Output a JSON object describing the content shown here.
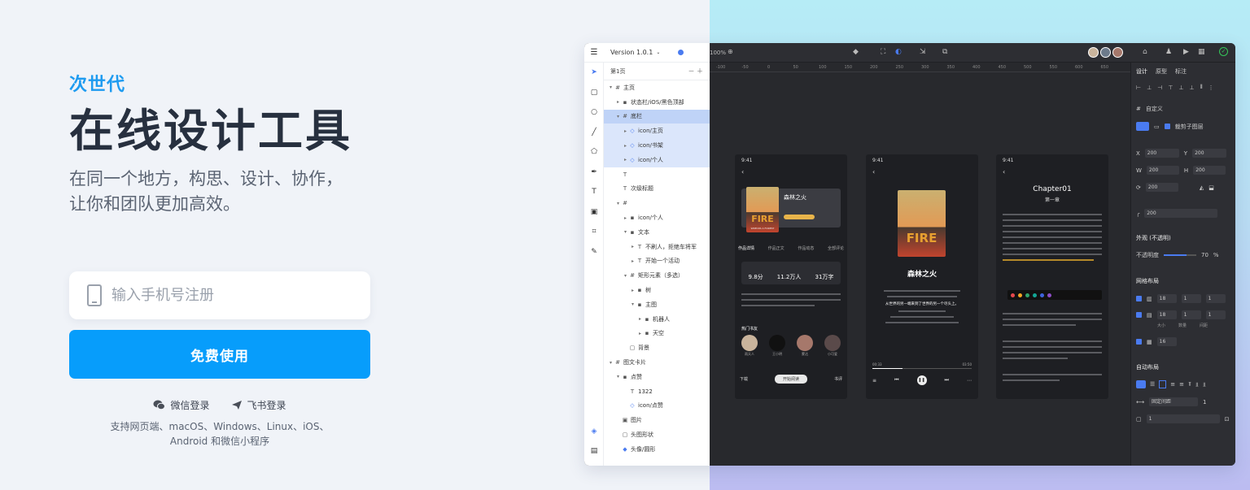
{
  "hero": {
    "tag": "次世代",
    "title": "在线设计工具",
    "subtitle_line1": "在同一个地方，构思、设计、协作，",
    "subtitle_line2": "让你和团队更加高效。"
  },
  "signup": {
    "phone_placeholder": "输入手机号注册",
    "free_button": "免费使用",
    "wechat_login": "微信登录",
    "feishu_login": "飞书登录",
    "platforms_line1": "支持网页端、macOS、Windows、Linux、iOS、",
    "platforms_line2": "Android 和微信小程序"
  },
  "editor": {
    "version": "Version 1.0.1",
    "page": "第1页",
    "zoom": "100%",
    "layers": [
      {
        "indent": 0,
        "arrow": "▾",
        "icon": "#",
        "label": "主页",
        "sel": false
      },
      {
        "indent": 1,
        "arrow": "▸",
        "icon": "▪",
        "label": "状态栏/iOS/黑色顶部",
        "sel": false
      },
      {
        "indent": 1,
        "arrow": "▾",
        "icon": "#",
        "label": "底栏",
        "sel": true,
        "head": true
      },
      {
        "indent": 2,
        "arrow": "▸",
        "icon": "◇",
        "label": "icon/主页",
        "sel": true
      },
      {
        "indent": 2,
        "arrow": "▸",
        "icon": "◇",
        "label": "icon/书架",
        "sel": true
      },
      {
        "indent": 2,
        "arrow": "▸",
        "icon": "◇",
        "label": "icon/个人",
        "sel": true
      },
      {
        "indent": 1,
        "arrow": "",
        "icon": "T",
        "label": "",
        "sel": false
      },
      {
        "indent": 1,
        "arrow": "",
        "icon": "T",
        "label": "次级标题",
        "sel": false
      },
      {
        "indent": 1,
        "arrow": "▾",
        "icon": "#",
        "label": "",
        "sel": false
      },
      {
        "indent": 2,
        "arrow": "▸",
        "icon": "▪",
        "label": "icon/个人",
        "sel": false
      },
      {
        "indent": 2,
        "arrow": "▾",
        "icon": "▪",
        "label": "文本",
        "sel": false
      },
      {
        "indent": 3,
        "arrow": "▸",
        "icon": "T",
        "label": "不刷人，拒绝车将军",
        "sel": false
      },
      {
        "indent": 3,
        "arrow": "▸",
        "icon": "T",
        "label": "开始一个活动",
        "sel": false
      },
      {
        "indent": 2,
        "arrow": "▾",
        "icon": "#",
        "label": "矩形元素（多选）",
        "sel": false
      },
      {
        "indent": 3,
        "arrow": "▸",
        "icon": "▪",
        "label": "树",
        "sel": false
      },
      {
        "indent": 3,
        "arrow": "▾",
        "icon": "▪",
        "label": "主图",
        "sel": false
      },
      {
        "indent": 4,
        "arrow": "▸",
        "icon": "▪",
        "label": "机器人",
        "sel": false
      },
      {
        "indent": 4,
        "arrow": "▸",
        "icon": "▪",
        "label": "天空",
        "sel": false
      },
      {
        "indent": 2,
        "arrow": "",
        "icon": "▢",
        "label": "背景",
        "sel": false
      },
      {
        "indent": 0,
        "arrow": "▾",
        "icon": "#",
        "label": "图文卡片",
        "sel": false
      },
      {
        "indent": 1,
        "arrow": "▾",
        "icon": "▪",
        "label": "点赞",
        "sel": false
      },
      {
        "indent": 2,
        "arrow": "",
        "icon": "T",
        "label": "1322",
        "sel": false
      },
      {
        "indent": 2,
        "arrow": "",
        "icon": "◇",
        "label": "icon/点赞",
        "sel": false
      },
      {
        "indent": 1,
        "arrow": "",
        "icon": "▣",
        "label": "图片",
        "sel": false
      },
      {
        "indent": 1,
        "arrow": "",
        "icon": "▢",
        "label": "头图形状",
        "sel": false
      },
      {
        "indent": 1,
        "arrow": "",
        "icon": "◆",
        "label": "头像/圆形",
        "sel": false
      }
    ],
    "ruler": [
      "-100",
      "-50",
      "0",
      "50",
      "100",
      "150",
      "200",
      "250",
      "300",
      "350",
      "400",
      "450",
      "500",
      "550",
      "600",
      "650"
    ],
    "phone1": {
      "time": "9:41",
      "book_title": "森林之火",
      "cover_text": "FIRE",
      "cover_sub": "WRECKS A FOREST",
      "tabs": [
        "作品详情",
        "作品正文",
        "作品动态",
        "全部评论"
      ],
      "stat1": "9.8分",
      "stat2": "11.2万人",
      "stat3": "31万字",
      "section": "热门书友",
      "readers": [
        "雨天人",
        "王小明",
        "蒙达",
        "小可爱"
      ],
      "bottom": [
        "下载",
        "开始阅读",
        "书评"
      ]
    },
    "phone2": {
      "time": "9:41",
      "title": "森林之火",
      "highlight": "从世界的另一端来到了世界的另一个尽头上。",
      "start": "00:33",
      "end": "03:50"
    },
    "phone3": {
      "time": "9:41",
      "chapter": "Chapter01",
      "chapter_cn": "第一章"
    },
    "right_tabs": [
      "设计",
      "原型",
      "标注"
    ],
    "frame": "自定义",
    "clip": "裁剪子图层",
    "x": "200",
    "y": "200",
    "w": "200",
    "h": "200",
    "rot": "200",
    "radius": "200",
    "layer_section": "外观 (不透明)",
    "opacity_label": "不透明度",
    "opacity_value": "70",
    "opacity_fraction": 0.7,
    "grid_section": "网格布局",
    "grid_rows": [
      [
        "18",
        "1",
        "1"
      ],
      [
        "18",
        "1",
        "1"
      ],
      [
        "16"
      ]
    ],
    "grid_labels": [
      "大小",
      "数量",
      "间距"
    ],
    "auto_section": "自动布局",
    "spacing": "固定间距",
    "spacing_val": "1",
    "padding_val": "1"
  },
  "colors": {
    "accent": "#079dfb",
    "tag": "#1e9bf0",
    "dark_bg": "#28292d",
    "selection": "#dbe6fb"
  }
}
